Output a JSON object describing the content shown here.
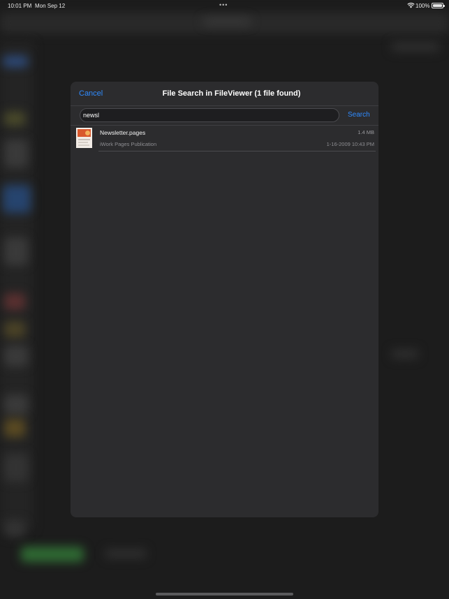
{
  "status_bar": {
    "time": "10:01 PM",
    "date": "Mon Sep 12",
    "center_indicator": "•••",
    "wifi_icon": "wifi-icon",
    "battery_percent": "100%",
    "battery_level": 1.0
  },
  "modal": {
    "cancel_label": "Cancel",
    "title": "File Search in FileViewer (1 file found)",
    "search": {
      "value": "newsl",
      "button_label": "Search"
    },
    "results": [
      {
        "icon": "pages-document-thumbnail",
        "name": "Newsletter.pages",
        "size": "1.4 MB",
        "kind": "iWork Pages Publication",
        "date": "1-16-2009 10:43 PM"
      }
    ]
  },
  "colors": {
    "accent": "#2f8bff",
    "modal_background": "#2c2c2e",
    "page_background": "#1c1c1c"
  }
}
